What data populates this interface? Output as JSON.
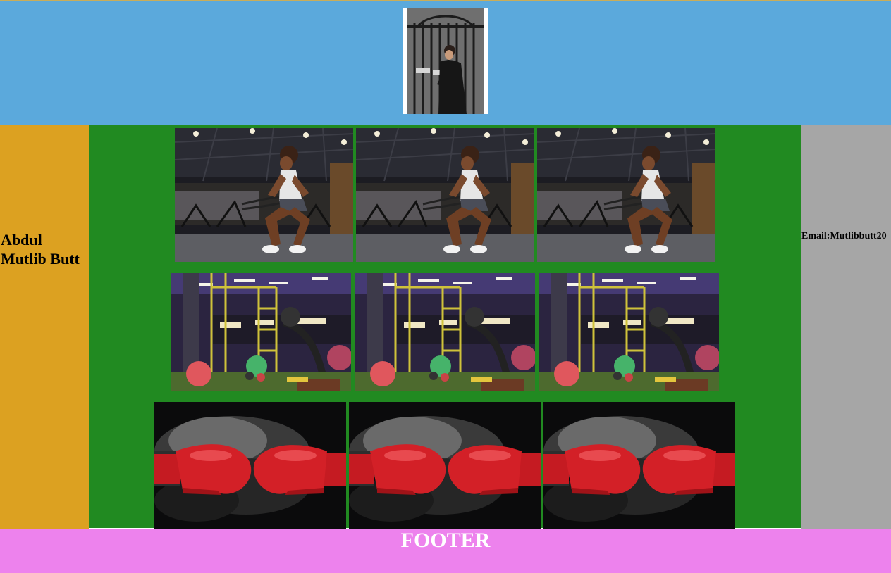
{
  "header": {
    "profile_image": "profile-photo"
  },
  "sidebar_left": {
    "name": "Abdul Mutlib Butt"
  },
  "sidebar_right": {
    "email": "Email:Mutlibbutt20"
  },
  "gallery": {
    "rows": [
      {
        "image": "gym-workout-photo",
        "count": 3
      },
      {
        "image": "gym-interior-photo",
        "count": 3
      },
      {
        "image": "boxing-gloves-photo",
        "count": 3
      }
    ]
  },
  "footer": {
    "title": "FOOTER"
  },
  "colors": {
    "header_bg": "#5ba9dc",
    "left_bg": "#dca121",
    "main_bg": "#218a21",
    "right_bg": "#a6a6a6",
    "footer_bg": "#ed82ed"
  }
}
